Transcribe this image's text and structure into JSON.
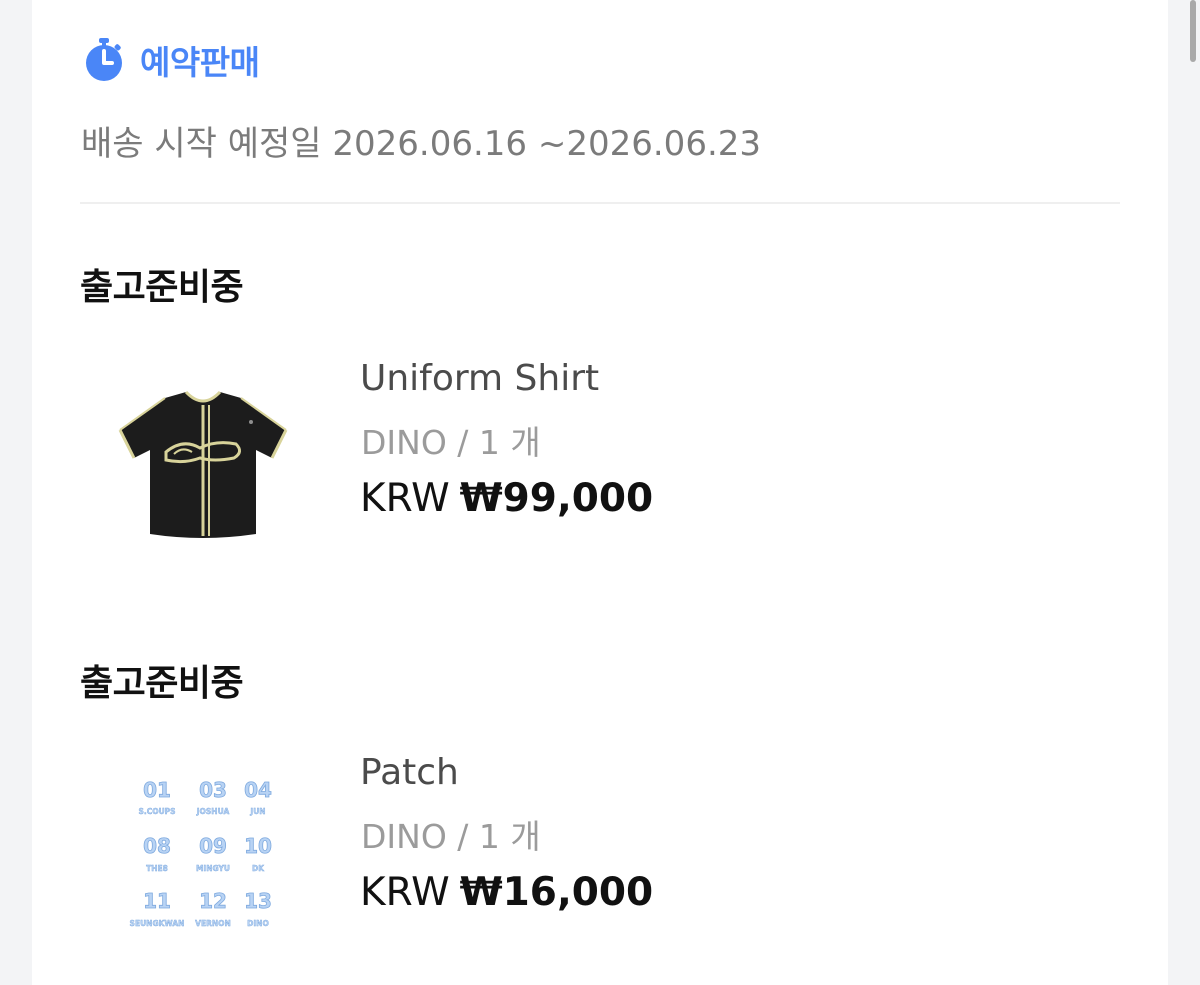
{
  "preorder": {
    "title": "예약판매",
    "shipping_label": "배송 시작 예정일 2026.06.16 ~2026.06.23",
    "icon": "stopwatch-icon",
    "accent_color": "#4a86f7"
  },
  "items": [
    {
      "status": "출고준비중",
      "name": "Uniform Shirt",
      "option": "DINO / 1 개",
      "currency": "KRW",
      "price": "₩99,000",
      "thumbnail": "uniform-shirt-image"
    },
    {
      "status": "출고준비중",
      "name": "Patch",
      "option": "DINO / 1 개",
      "currency": "KRW",
      "price": "₩16,000",
      "thumbnail": "patch-image",
      "patch_numbers": [
        "01",
        "03",
        "04",
        "08",
        "09",
        "10",
        "11",
        "12",
        "13"
      ],
      "patch_names": [
        "S.COUPS",
        "JOSHUA",
        "JUN",
        "THE8",
        "MINGYU",
        "DK",
        "SEUNGKWAN",
        "VERNON",
        "DINO"
      ]
    }
  ]
}
